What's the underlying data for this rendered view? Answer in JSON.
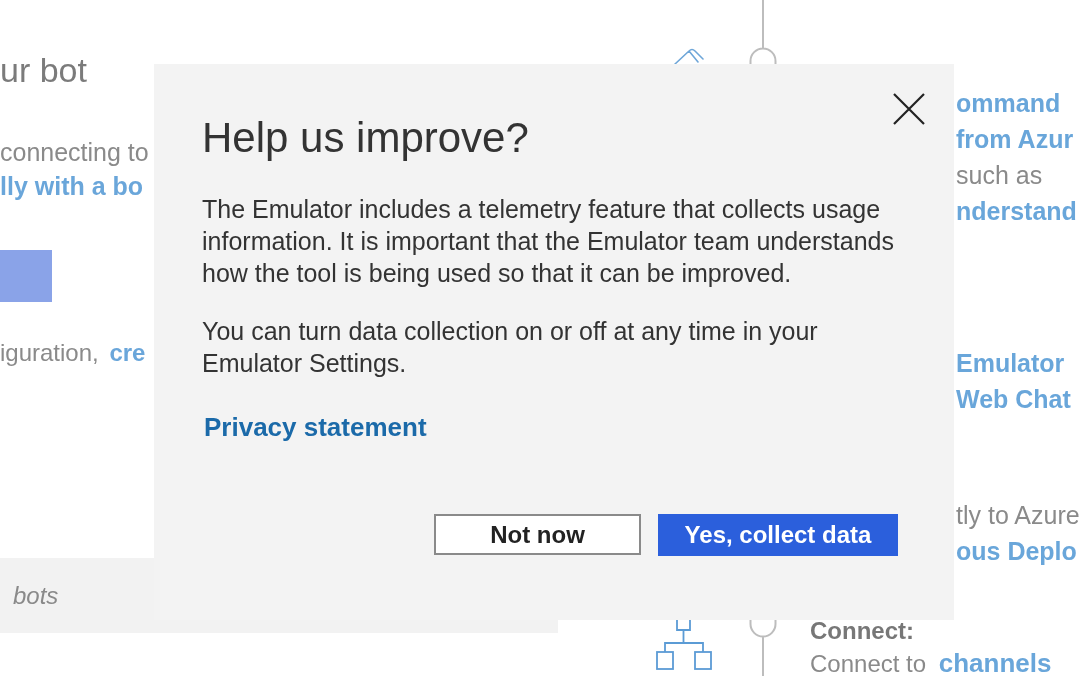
{
  "left_pane": {
    "heading": "ur bot",
    "description": "connecting to",
    "link": "lly with a bo",
    "config_text": "iguration,",
    "config_link": "cre",
    "list_header": "bots"
  },
  "right_pane": {
    "line_groups": [
      [
        {
          "kind": "link",
          "text": "ommand"
        },
        {
          "kind": "link",
          "text": "from Azur"
        },
        {
          "kind": "text",
          "text": "such as"
        },
        {
          "kind": "link",
          "text": "nderstand"
        }
      ],
      [
        {
          "kind": "link",
          "text": "Emulator"
        },
        {
          "kind": "link",
          "text": "Web Chat"
        }
      ],
      [
        {
          "kind": "text",
          "text": "tly to Azure"
        },
        {
          "kind": "link",
          "text": "ous Deplo"
        }
      ]
    ],
    "connect_title": "Connect:",
    "connect_text": "Connect to",
    "connect_link": "channels"
  },
  "dialog": {
    "title": "Help us improve?",
    "paragraphs": [
      "The Emulator includes a telemetry feature that collects usage information. It is important that the Emulator team understands how the tool is being used so that it can be improved.",
      "You can turn data collection on or off at any time in your Emulator Settings."
    ],
    "link": "Privacy statement",
    "buttons": [
      {
        "kind": "secondary",
        "label": "Not now"
      },
      {
        "kind": "primary",
        "label": "Yes, collect data"
      }
    ]
  }
}
